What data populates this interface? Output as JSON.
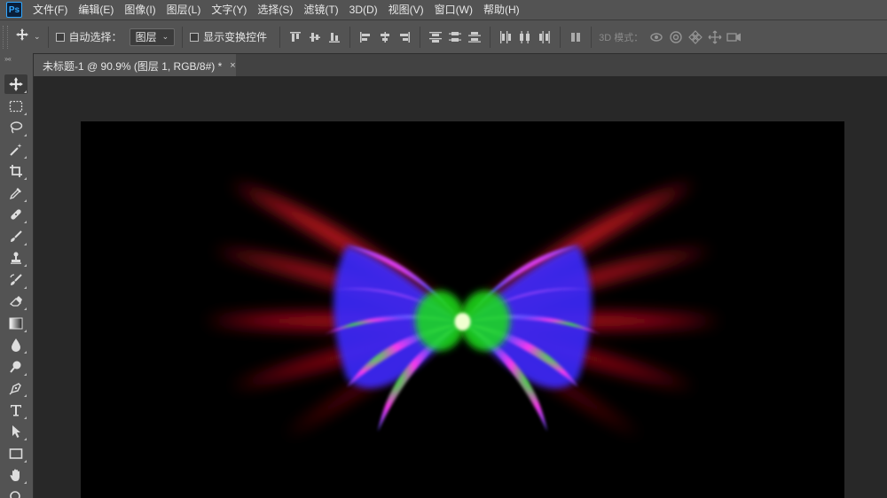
{
  "app": {
    "logo": "Ps"
  },
  "menu": [
    "文件(F)",
    "编辑(E)",
    "图像(I)",
    "图层(L)",
    "文字(Y)",
    "选择(S)",
    "滤镜(T)",
    "3D(D)",
    "视图(V)",
    "窗口(W)",
    "帮助(H)"
  ],
  "options": {
    "auto_select_label": "自动选择：",
    "auto_select_checked": false,
    "auto_select_target": "图层",
    "show_transform_label": "显示变换控件",
    "show_transform_checked": false,
    "mode_3d_label": "3D 模式："
  },
  "document": {
    "tab_title": "未标题-1 @ 90.9% (图层 1, RGB/8#) *",
    "close_glyph": "×"
  },
  "colors": {
    "ui_panel": "#535353",
    "workspace": "#282828",
    "canvas": "#000000",
    "wing_red": "#ff1a2a",
    "wing_blue": "#4a3cff",
    "wing_magenta": "#ff3df0",
    "wing_green": "#22ee22"
  },
  "toolbox": {
    "tools": [
      "move-tool",
      "marquee-tool",
      "lasso-tool",
      "magic-wand-tool",
      "crop-tool",
      "eyedropper-tool",
      "healing-brush-tool",
      "brush-tool",
      "clone-stamp-tool",
      "history-brush-tool",
      "eraser-tool",
      "gradient-tool",
      "blur-tool",
      "dodge-tool",
      "pen-tool",
      "type-tool",
      "path-selection-tool",
      "rectangle-tool",
      "hand-tool",
      "zoom-tool"
    ],
    "active": "move-tool"
  }
}
